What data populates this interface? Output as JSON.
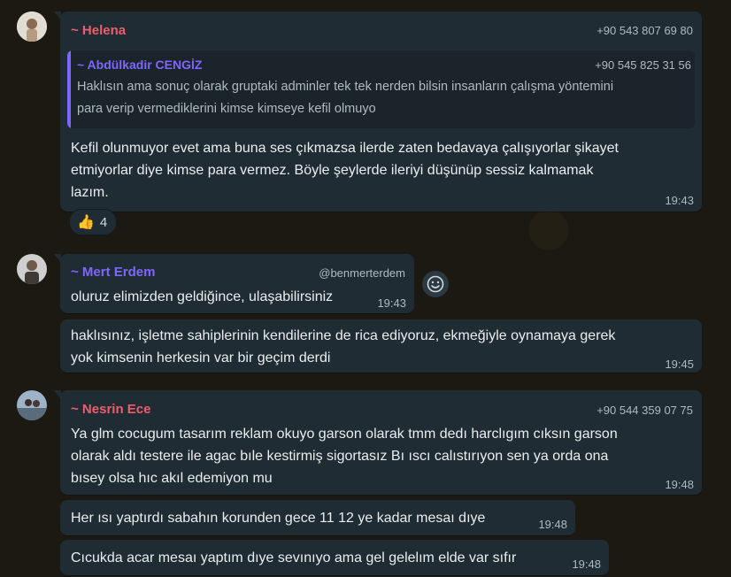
{
  "colors": {
    "bubble": "#202c33",
    "quote_bg": "#1a242a",
    "quote_bar": "#7f66ff",
    "helena": "#f15c6d",
    "abdulkadir": "#7f66ff",
    "mert": "#7f66ff",
    "nesrin": "#f15c6d"
  },
  "messages": [
    {
      "sender": "~ Helena",
      "phone": "+90 543 807 69 80",
      "quote": {
        "sender": "~ Abdülkadir CENGİZ",
        "phone": "+90 545 825 31 56",
        "line1": "Haklısın ama sonuç olarak gruptaki adminler tek tek nerden bilsin insanların çalışma yöntemini",
        "line2": "para verip vermediklerini kimse kimseye kefil olmuyo"
      },
      "line1": "Kefil olunmuyor evet ama buna ses çıkmazsa ilerde zaten bedavaya çalışıyorlar şikayet",
      "line2": "etmiyorlar diye kimse para vermez. Böyle şeylerde ileriyi düşünüp sessiz kalmamak",
      "line3": "lazım.",
      "time": "19:43",
      "reaction": {
        "icon": "thumbs-up",
        "count": "4"
      }
    },
    {
      "sender": "~ Mert Erdem",
      "username": "@benmerterdem",
      "line1": "oluruz elimizden geldiğince, ulaşabilirsiniz",
      "time": "19:43"
    },
    {
      "line1": "haklısınız, işletme sahiplerinin kendilerine de rica ediyoruz, ekmeğiyle oynamaya gerek",
      "line2": "yok kimsenin herkesin var bir geçim derdi",
      "time": "19:45"
    },
    {
      "sender": "~ Nesrin Ece",
      "phone": "+90 544 359 07 75",
      "line1": "Ya glm cocugum tasarım reklam okuyo garson olarak tmm dedı harclıgım cıksın garson",
      "line2": "olarak aldı testere ile agac bıle kestirmiş sigortasız Bı ıscı calıstırıyon sen ya orda ona",
      "line3": "bısey olsa hıc akıl edemiyon mu",
      "time": "19:48"
    },
    {
      "line1": "Her ısı yaptırdı sabahın korunden gece 11 12 ye kadar mesaı dıye",
      "time": "19:48"
    },
    {
      "line1": "Cıcukda acar mesaı yaptım dıye sevınıyo ama gel gelelım elde var sıfır",
      "time": "19:48"
    }
  ]
}
